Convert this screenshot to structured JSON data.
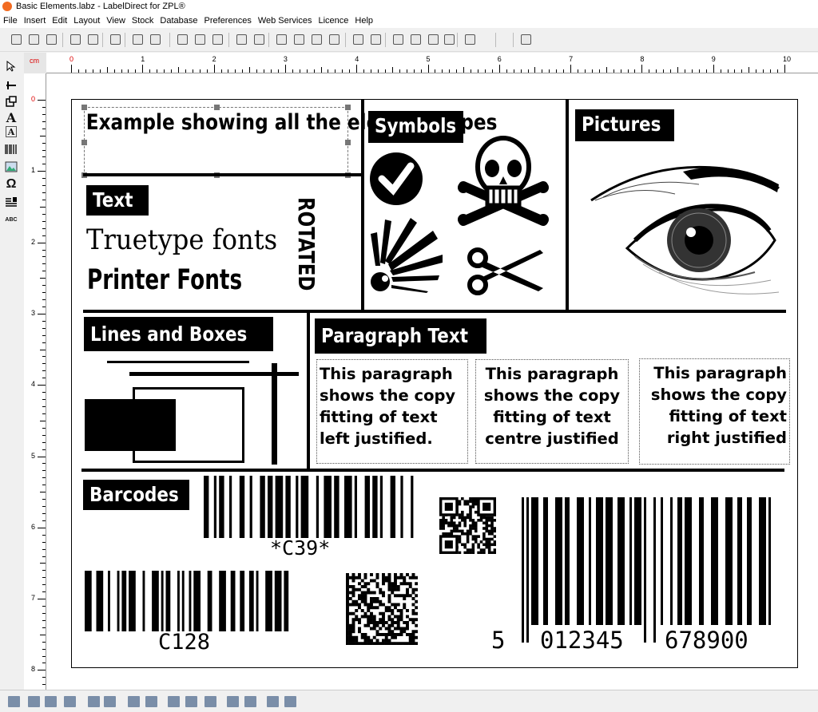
{
  "window": {
    "title": "Basic Elements.labz - LabelDirect for ZPL®"
  },
  "menu": [
    "File",
    "Insert",
    "Edit",
    "Layout",
    "View",
    "Stock",
    "Database",
    "Preferences",
    "Web Services",
    "Licence",
    "Help"
  ],
  "ruler": {
    "unit": "cm",
    "h_labels": [
      "0",
      "1",
      "2",
      "3",
      "4",
      "5",
      "6",
      "7",
      "8",
      "9",
      "10"
    ],
    "v_labels": [
      "0",
      "1",
      "2",
      "3",
      "4",
      "5",
      "6",
      "7",
      "8"
    ]
  },
  "toolbar": {
    "icons": [
      "new-icon",
      "open-icon",
      "save-icon",
      "copy-label-icon",
      "paste-label-icon",
      "template-icon",
      "print-icon",
      "print-preview-icon",
      "cut-icon",
      "copy-icon",
      "paste-icon",
      "undo-icon",
      "redo-icon",
      "zoom-fit-icon",
      "zoom-100-icon",
      "zoom-in-icon",
      "zoom-out-icon",
      "properties-icon",
      "group-icon",
      "delete-icon",
      "refresh-icon",
      "bring-front-icon",
      "send-back-icon",
      "warning-icon",
      "help-icon"
    ]
  },
  "lefttools": {
    "icons": [
      "pointer-icon",
      "line-icon",
      "box-icon",
      "text-icon",
      "printer-font-icon",
      "barcode-icon",
      "picture-icon",
      "symbol-icon",
      "paragraph-icon",
      "rotate-text-icon"
    ],
    "text_tool": "A",
    "symbol_tool": "Ω",
    "arc_tool": "ABC"
  },
  "label": {
    "heading": "Example showing all the element types",
    "text_section": {
      "header": "Text",
      "truetype": "Truetype fonts",
      "printer": "Printer Fonts",
      "rotated": "ROTATED"
    },
    "symbols": {
      "header": "Symbols"
    },
    "pictures": {
      "header": "Pictures"
    },
    "lines": {
      "header": "Lines and Boxes"
    },
    "paragraph": {
      "header": "Paragraph Text",
      "left": [
        "This paragraph",
        "shows the copy",
        "fitting of text",
        "left justified."
      ],
      "centre": [
        "This paragraph",
        "shows the copy",
        "fitting of text",
        "centre justified"
      ],
      "right": [
        "This paragraph",
        "shows the copy",
        "fitting of text",
        "right justified"
      ]
    },
    "barcodes": {
      "header": "Barcodes",
      "code39": "*C39*",
      "code128": "C128",
      "upc_left": "5",
      "upc_mid": "012345",
      "upc_right": "678900"
    }
  },
  "statusbar": {
    "icons": [
      "align-left-icon",
      "align-center-icon",
      "align-right-icon",
      "align-top-icon",
      "align-middle-icon",
      "align-bottom-icon",
      "distribute-h-icon",
      "distribute-v-icon",
      "same-width-icon",
      "same-height-icon",
      "same-size-icon",
      "space-h-icon",
      "space-v-icon",
      "font-size-icon",
      "menu-icon"
    ]
  }
}
